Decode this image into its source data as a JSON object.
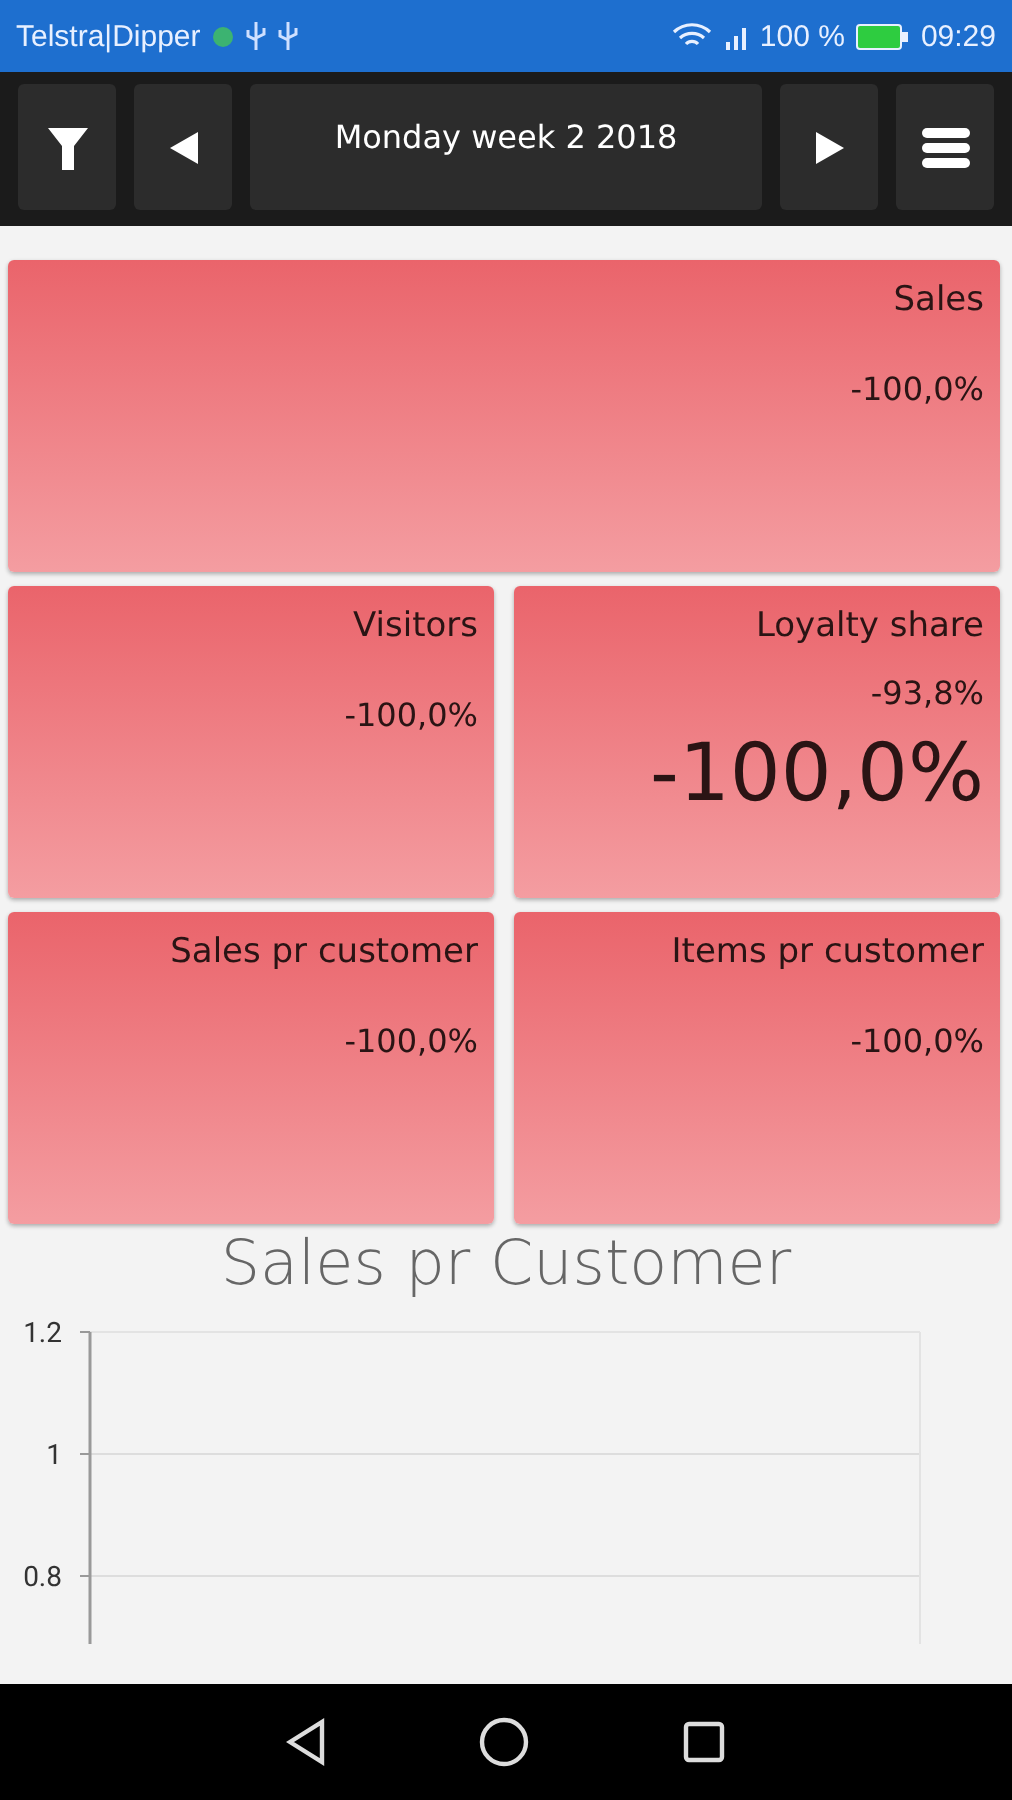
{
  "status_bar": {
    "carrier": "Telstra|Dipper",
    "battery": "100 %",
    "time": "09:29"
  },
  "toolbar": {
    "period": "Monday week 2 2018"
  },
  "tiles": [
    {
      "kind": "wide",
      "title": "Sales",
      "change": "-100,0%"
    },
    {
      "kind": "half",
      "title": "Visitors",
      "change": "-100,0%"
    },
    {
      "kind": "half",
      "title": "Loyalty share",
      "change": "-93,8%",
      "value": "-100,0%"
    },
    {
      "kind": "half",
      "title": "Sales pr customer",
      "change": "-100,0%"
    },
    {
      "kind": "half",
      "title": "Items pr customer",
      "change": "-100,0%"
    }
  ],
  "chart": {
    "title": "Sales pr Customer",
    "y_axis_labels": [
      "1.2",
      "1",
      "0.8"
    ]
  }
}
